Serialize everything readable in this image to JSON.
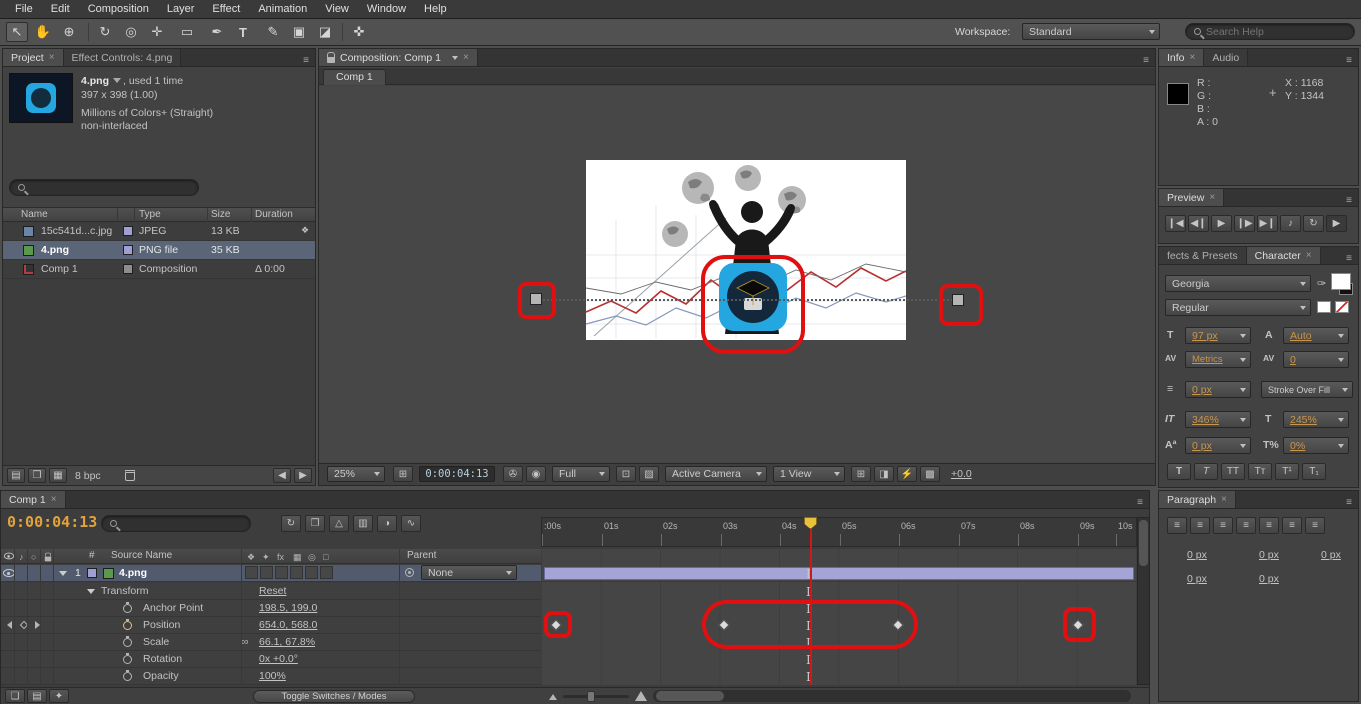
{
  "colors": {
    "value_orange": "#c9964b",
    "timecode_orange": "#e2a33c",
    "annotation_red": "#e01010",
    "layer_bar_lavender": "#a4a4d6",
    "selected_row_blue": "#5a6577"
  },
  "icons": {
    "close": "×",
    "menu": "≡",
    "plus": "+",
    "link": "∞",
    "eyedropper": "✑"
  },
  "menu": {
    "items": [
      "File",
      "Edit",
      "Composition",
      "Layer",
      "Effect",
      "Animation",
      "View",
      "Window",
      "Help"
    ]
  },
  "toolbar": {
    "tools": [
      "↖",
      "✋",
      "⊕",
      "↻",
      "◎",
      "✛",
      "▭",
      "✒",
      "T",
      "✎",
      "▣",
      "◪",
      "✜"
    ],
    "workspace_label": "Workspace:",
    "workspace_value": "Standard",
    "search_placeholder": "Search Help"
  },
  "project": {
    "tab": "Project",
    "tab2": "Effect Controls: 4.png",
    "sel_name": "4.png",
    "sel_usage": ", used 1 time",
    "sel_dims": "397 x 398 (1.00)",
    "sel_depth": "Millions of Colors+ (Straight)",
    "sel_interlace": "non-interlaced",
    "cols": {
      "name": "Name",
      "type": "Type",
      "size": "Size",
      "duration": "Duration"
    },
    "rows": [
      {
        "name": "15c541d...c.jpg",
        "type": "JPEG",
        "size": "13 KB",
        "duration": ""
      },
      {
        "name": "4.png",
        "type": "PNG file",
        "size": "35 KB",
        "duration": ""
      },
      {
        "name": "Comp 1",
        "type": "Composition",
        "size": "",
        "duration": "Δ 0:00"
      }
    ],
    "bpc": "8 bpc"
  },
  "comp": {
    "tab": "Composition: Comp 1",
    "viewer_tab": "Comp 1",
    "zoom": "25%",
    "timecode": "0:00:04:13",
    "resolution": "Full",
    "camera": "Active Camera",
    "view": "1 View",
    "exposure": "+0.0",
    "footer_icons": [
      "⊞",
      "✇",
      "◉",
      "⊡",
      "▨",
      "⊞",
      "◨",
      "⚡",
      "▩"
    ]
  },
  "info": {
    "tab": "Info",
    "tab2": "Audio",
    "r": "R :",
    "g": "G :",
    "b": "B :",
    "a": "A : 0",
    "x": "X : 1168",
    "y": "Y : 1344"
  },
  "preview": {
    "tab": "Preview",
    "buttons": [
      "❙◀",
      "◀❙",
      "▶",
      "❙▶",
      "▶❙",
      "♪",
      "↻",
      "▶"
    ]
  },
  "character": {
    "tab_left": "fects & Presets",
    "tab": "Character",
    "font": "Georgia",
    "style": "Regular",
    "size_icon": "T",
    "size": "97 px",
    "leading_icon": "A",
    "leading": "Auto",
    "kern_icon": "AV",
    "kern": "Metrics",
    "track_icon": "AV",
    "track": "0",
    "stroke_icon": "≡",
    "stroke_width": "0 px",
    "stroke_mode": "Stroke Over Fill",
    "vscale_icon": "IT",
    "vscale": "346%",
    "hscale_icon": "T",
    "hscale": "245%",
    "baseline_icon": "Aª",
    "baseline": "0 px",
    "tsume_icon": "T%",
    "tsume": "0%",
    "faux": [
      "T",
      "T",
      "TT",
      "Tᴛ",
      "T¹",
      "T₁"
    ]
  },
  "paragraph": {
    "tab": "Paragraph",
    "aligns": [
      "≡",
      "≡",
      "≡",
      "≡",
      "≡",
      "≡",
      "≡"
    ],
    "fields": [
      "0 px",
      "0 px",
      "0 px",
      "0 px",
      "0 px"
    ]
  },
  "timeline": {
    "tab": "Comp 1",
    "timecode": "0:00:04:13",
    "ruler": [
      ":00s",
      "01s",
      "02s",
      "03s",
      "04s",
      "05s",
      "06s",
      "07s",
      "08s",
      "09s",
      "10s"
    ],
    "header_icons": [
      "↻",
      "❐",
      "△",
      "▥",
      "◑",
      "∿"
    ],
    "switch_icons": [
      "❖",
      "✦",
      "fx",
      "▦",
      "◎",
      "□"
    ],
    "hdr": {
      "hash": "#",
      "source": "Source Name",
      "parent": "Parent"
    },
    "layer": {
      "num": "1",
      "name": "4.png",
      "parent": "None"
    },
    "props": [
      {
        "name": "Transform",
        "value": "Reset"
      },
      {
        "name": "Anchor Point",
        "value": "198.5, 199.0"
      },
      {
        "name": "Position",
        "value": "654.0, 568.0"
      },
      {
        "name": "Scale",
        "value": "66.1, 67.8%"
      },
      {
        "name": "Rotation",
        "value": "0x +0.0°"
      },
      {
        "name": "Opacity",
        "value": "100%"
      }
    ],
    "bottom_icons": [
      "❏",
      "▤",
      "✦"
    ],
    "toggle": "Toggle Switches / Modes"
  }
}
